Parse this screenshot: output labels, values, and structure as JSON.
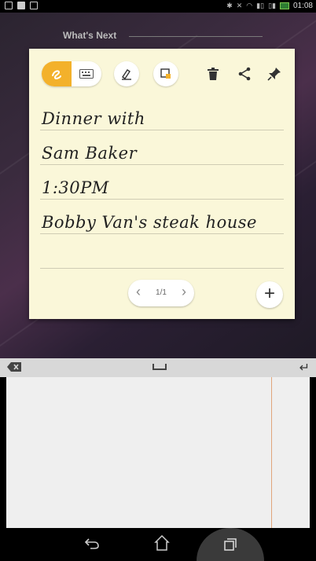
{
  "status_bar": {
    "time": "01:08"
  },
  "widget": {
    "header": "What's Next"
  },
  "note": {
    "lines": [
      "Dinner with",
      "Sam Baker",
      "1:30PM",
      "Bobby Van's steak house",
      ""
    ],
    "pager": "1/1",
    "add_label": "+"
  },
  "colors": {
    "accent": "#f3b12b",
    "note_bg": "#faf7d9",
    "keyboard_divider": "#e1a67b"
  },
  "icons": {
    "toolbar": [
      "pen-icon",
      "keyboard-icon",
      "highlighter-icon",
      "color-picker-icon",
      "trash-icon",
      "share-icon",
      "pin-icon"
    ],
    "keyboard": [
      "backspace-icon",
      "space-icon",
      "enter-icon"
    ],
    "navigation": [
      "back-icon",
      "home-icon",
      "recent-apps-icon"
    ]
  }
}
